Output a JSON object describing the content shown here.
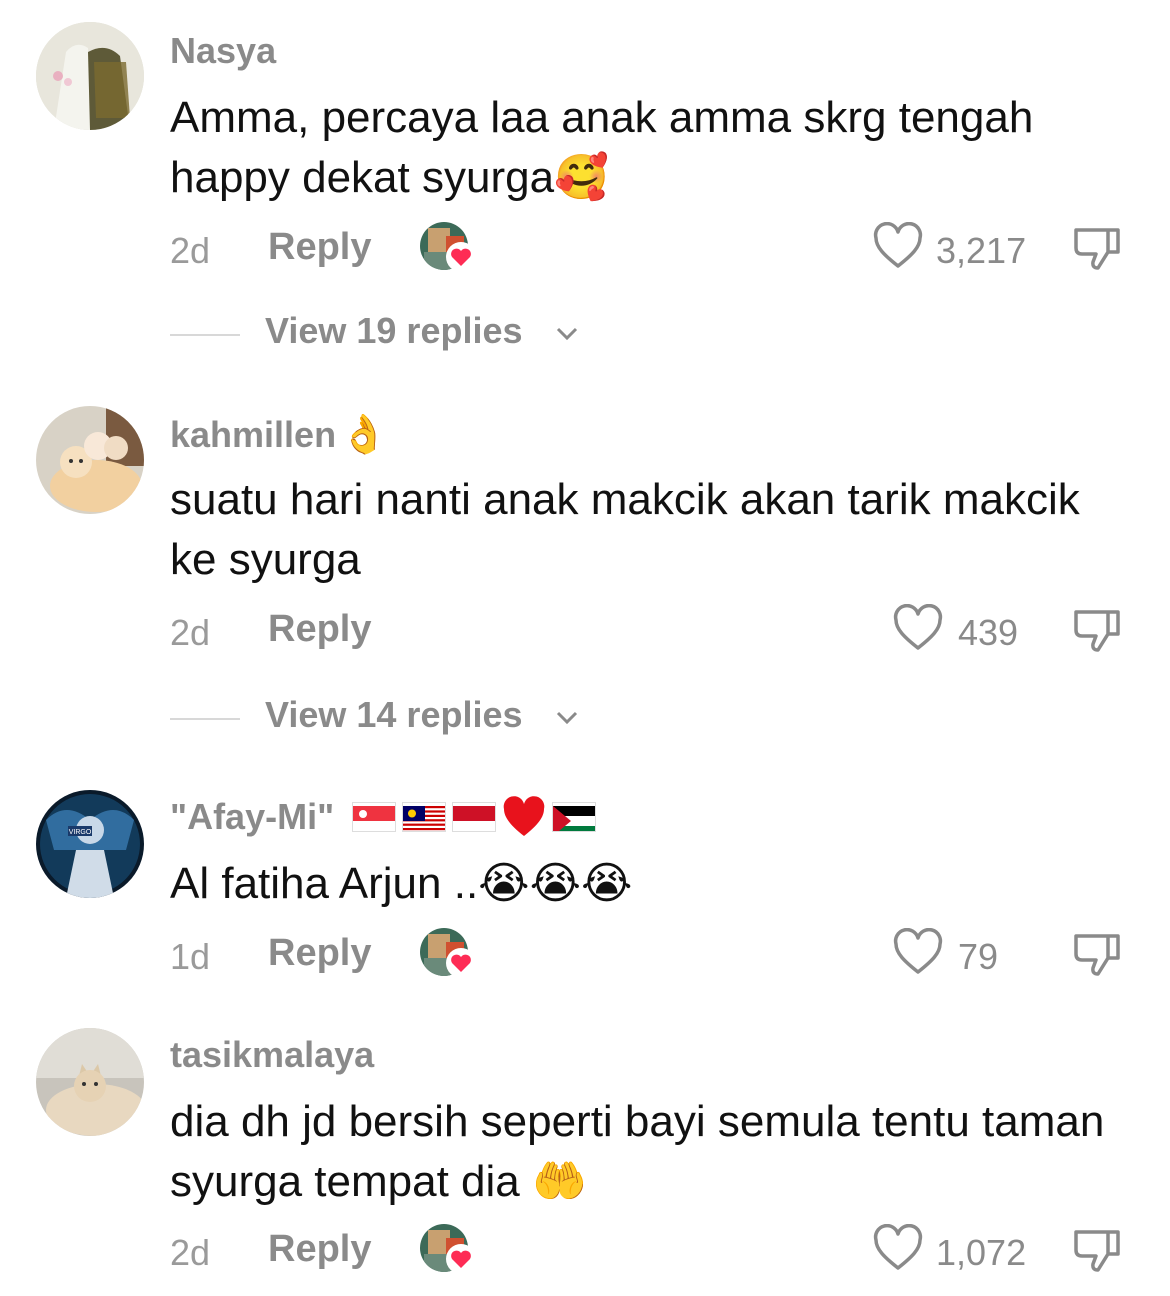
{
  "comments": [
    {
      "username": "Nasya",
      "username_emoji": "",
      "text": "Amma, percaya laa anak amma skrg tengah happy dekat syurga🥰",
      "time": "2d",
      "reply_label": "Reply",
      "likes": "3,217",
      "creator_liked": true,
      "view_replies": "View 19 replies"
    },
    {
      "username": "kahmillen",
      "username_emoji": "👌",
      "text": "suatu hari nanti anak makcik akan tarik makcik ke syurga",
      "time": "2d",
      "reply_label": "Reply",
      "likes": "439",
      "creator_liked": false,
      "view_replies": "View 14 replies"
    },
    {
      "username": "\"Afay-Mi\"",
      "username_flags": [
        "singapore-flag",
        "malaysia-flag",
        "indonesia-flag",
        "red-heart",
        "palestine-flag"
      ],
      "text": "Al fatiha Arjun ..😭😭😭",
      "time": "1d",
      "reply_label": "Reply",
      "likes": "79",
      "creator_liked": true,
      "avatar_text": "VIRGO"
    },
    {
      "username": "tasikmalaya",
      "username_emoji": "",
      "text": "dia dh jd bersih seperti bayi semula tentu taman syurga tempat dia 🤲",
      "time": "2d",
      "reply_label": "Reply",
      "likes": "1,072",
      "creator_liked": true
    }
  ],
  "colors": {
    "meta_gray": "#8a8a8a",
    "text": "#111111",
    "heart_red": "#fe2c55"
  },
  "icons": [
    "heart-outline-icon",
    "thumbs-down-icon",
    "chevron-down-icon",
    "creator-liked-heart-icon"
  ]
}
